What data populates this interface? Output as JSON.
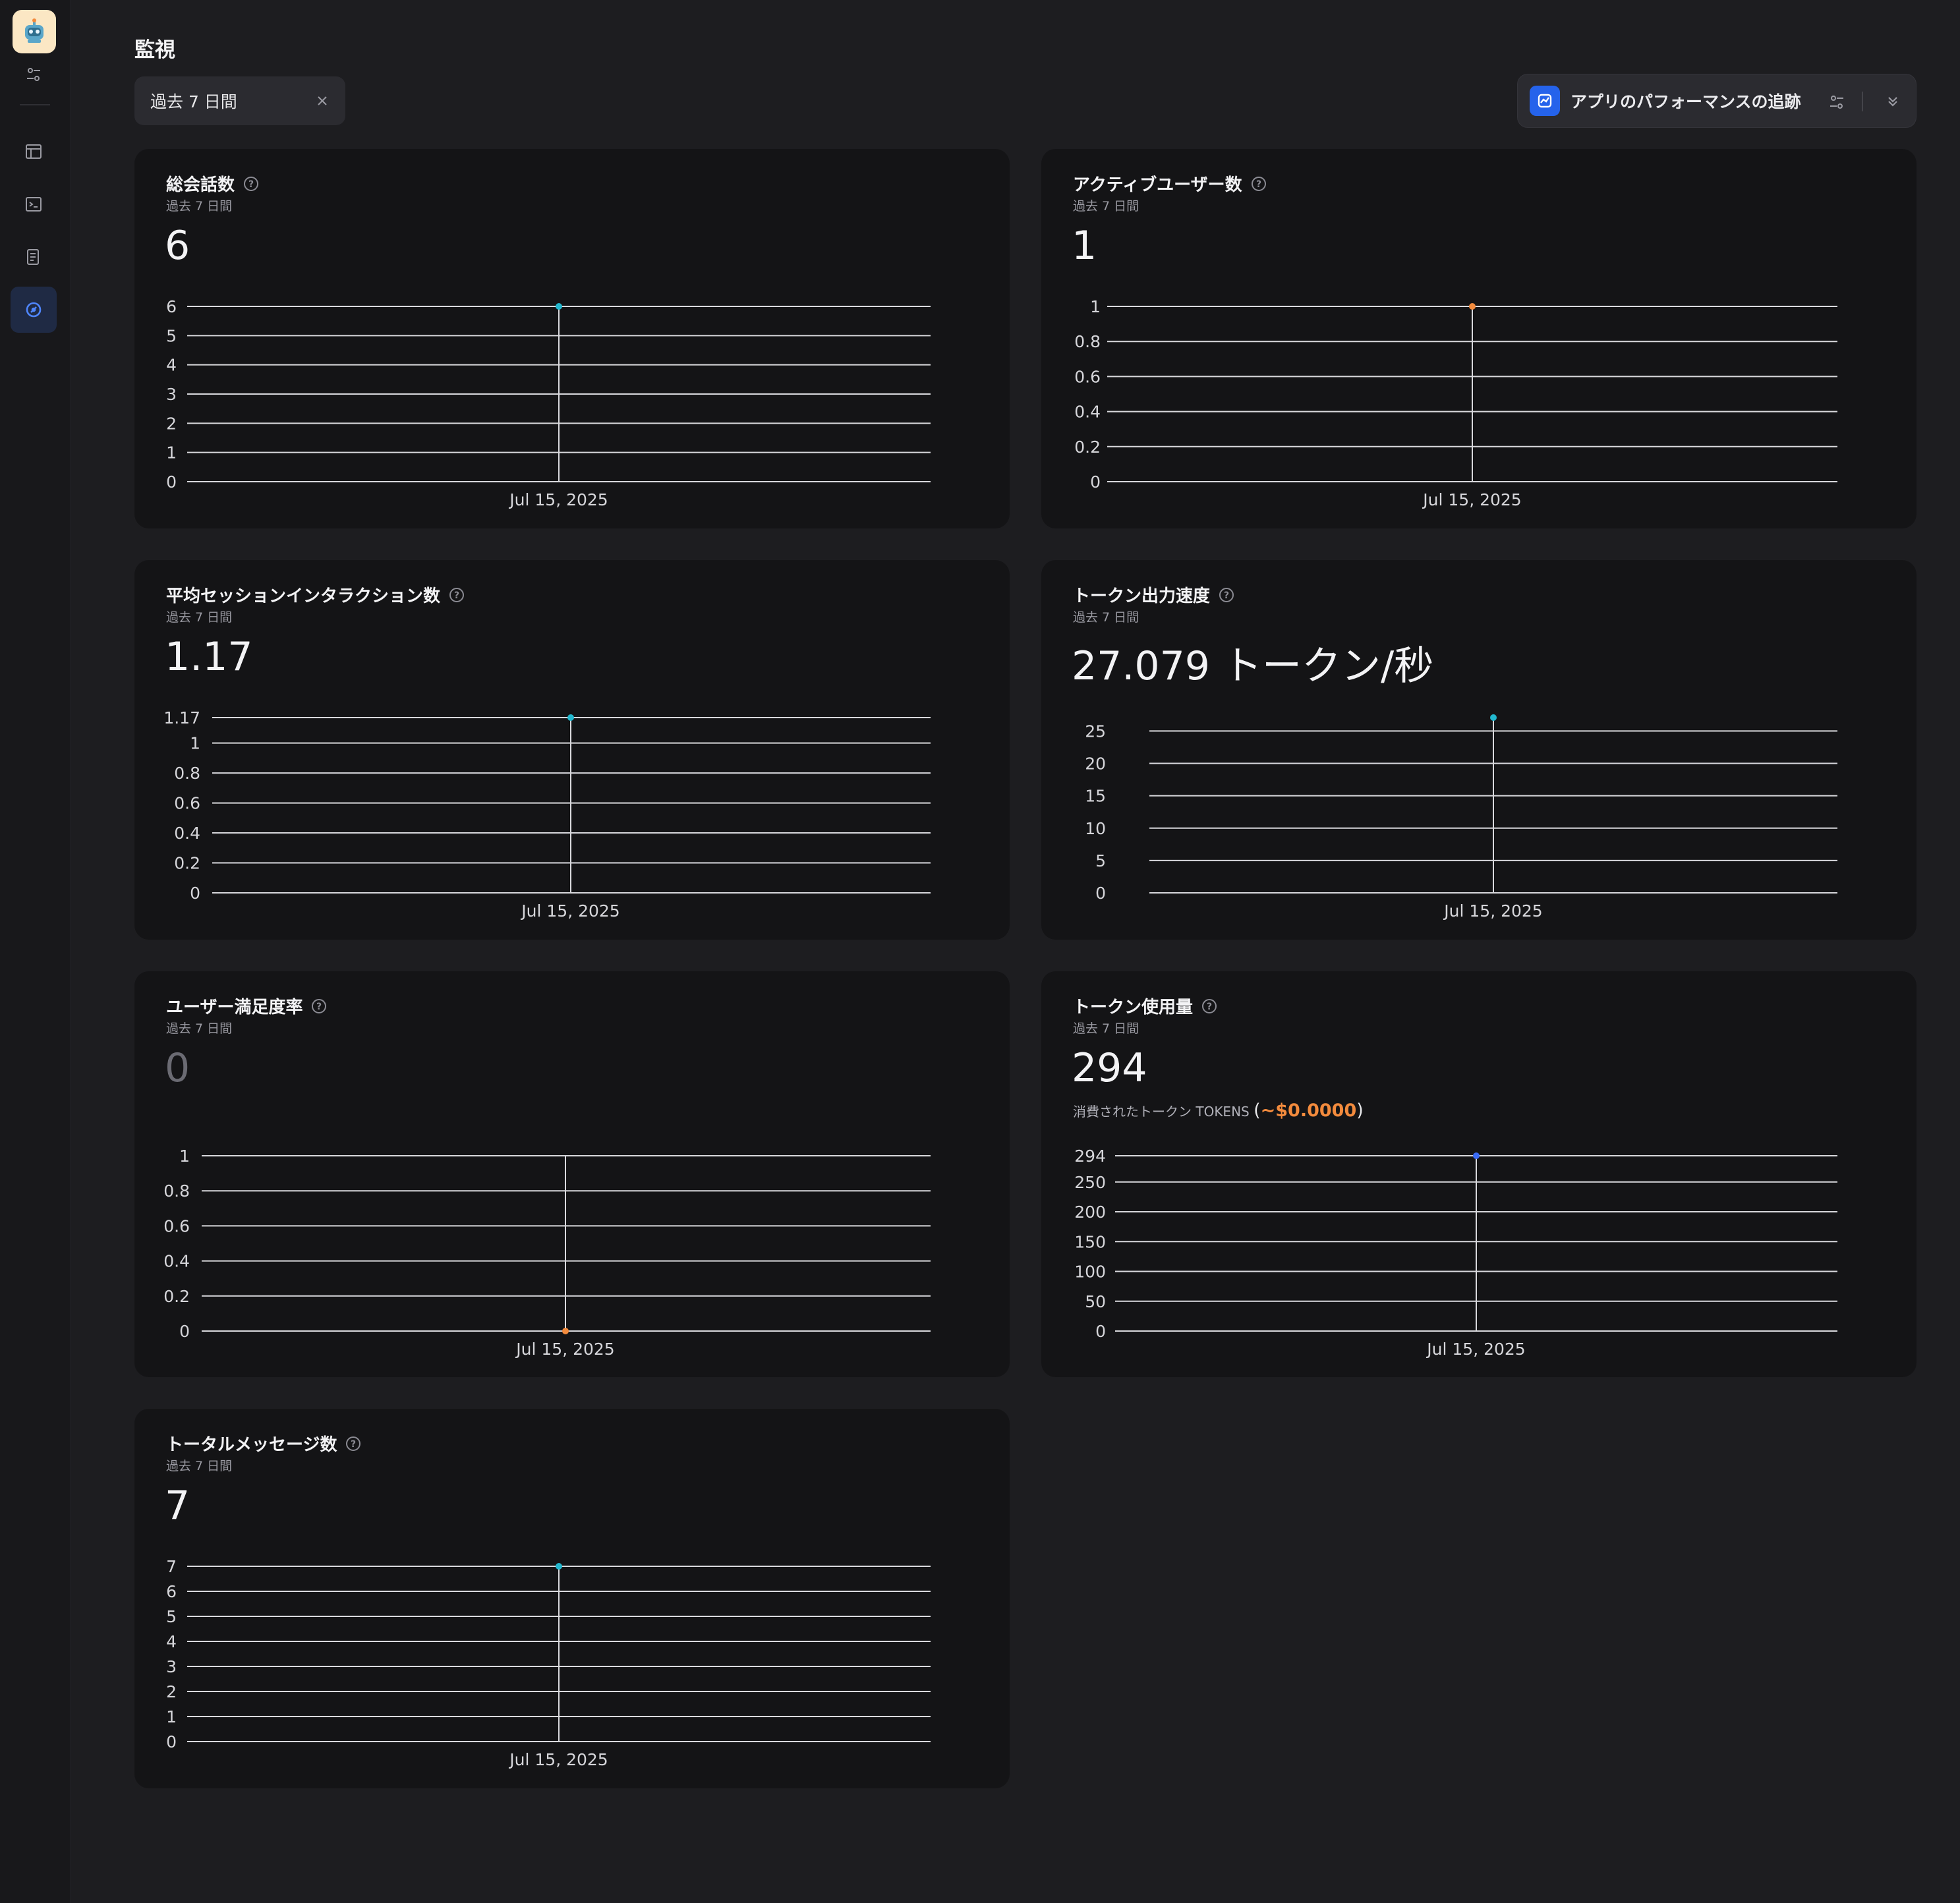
{
  "sidebar": {
    "active_index": 3
  },
  "header": {
    "title": "監視"
  },
  "filter": {
    "label": "過去 7 日間"
  },
  "tracing": {
    "label": "アプリのパフォーマンスの追跡"
  },
  "colors": {
    "accent_teal": "#22b8cf",
    "accent_orange": "#f38b3d",
    "accent_blue": "#3b6cf6",
    "brand_blue": "#2563eb"
  },
  "cards": [
    {
      "title": "総会話数",
      "subtitle": "過去 7 日間",
      "value": "6"
    },
    {
      "title": "アクティブユーザー数",
      "subtitle": "過去 7 日間",
      "value": "1"
    },
    {
      "title": "平均セッションインタラクション数",
      "subtitle": "過去 7 日間",
      "value": "1.17"
    },
    {
      "title": "トークン出力速度",
      "subtitle": "過去 7 日間",
      "value": "27.079 トークン/秒"
    },
    {
      "title": "ユーザー満足度率",
      "subtitle": "過去 7 日間",
      "value": "0"
    },
    {
      "title": "トークン使用量",
      "subtitle": "過去 7 日間",
      "value": "294",
      "tokens_label": "消費されたトークン TOKENS",
      "cost_open": "(",
      "cost": "~$0.0000",
      "cost_close": ")"
    },
    {
      "title": "トータルメッセージ数",
      "subtitle": "過去 7 日間",
      "value": "7"
    }
  ],
  "chart_data": [
    {
      "type": "line",
      "x": [
        "Jul 15, 2025"
      ],
      "series": [
        {
          "values": [
            6
          ]
        }
      ],
      "yticks": [
        "0",
        "1",
        "2",
        "3",
        "4",
        "5",
        "6"
      ],
      "ylim": [
        0,
        6
      ],
      "point_color": "#22b8cf"
    },
    {
      "type": "line",
      "x": [
        "Jul 15, 2025"
      ],
      "series": [
        {
          "values": [
            1
          ]
        }
      ],
      "yticks": [
        "0",
        "0.2",
        "0.4",
        "0.6",
        "0.8",
        "1"
      ],
      "ylim": [
        0,
        1
      ],
      "point_color": "#f38b3d"
    },
    {
      "type": "line",
      "x": [
        "Jul 15, 2025"
      ],
      "series": [
        {
          "values": [
            1.17
          ]
        }
      ],
      "yticks": [
        "0",
        "0.2",
        "0.4",
        "0.6",
        "0.8",
        "1",
        "1.17"
      ],
      "ylim": [
        0,
        1.17
      ],
      "point_color": "#22b8cf"
    },
    {
      "type": "line",
      "x": [
        "Jul 15, 2025"
      ],
      "series": [
        {
          "values": [
            27.079
          ]
        }
      ],
      "yticks": [
        "0",
        "5",
        "10",
        "15",
        "20",
        "25"
      ],
      "ylim": [
        0,
        27.079
      ],
      "point_color": "#22b8cf"
    },
    {
      "type": "line",
      "x": [
        "Jul 15, 2025"
      ],
      "series": [
        {
          "values": [
            0
          ]
        }
      ],
      "yticks": [
        "0",
        "0.2",
        "0.4",
        "0.6",
        "0.8",
        "1"
      ],
      "ylim": [
        0,
        1
      ],
      "point_color": "#f38b3d"
    },
    {
      "type": "line",
      "x": [
        "Jul 15, 2025"
      ],
      "series": [
        {
          "values": [
            294
          ]
        }
      ],
      "yticks": [
        "0",
        "50",
        "100",
        "150",
        "200",
        "250",
        "294"
      ],
      "ylim": [
        0,
        294
      ],
      "point_color": "#3b6cf6"
    },
    {
      "type": "line",
      "x": [
        "Jul 15, 2025"
      ],
      "series": [
        {
          "values": [
            7
          ]
        }
      ],
      "yticks": [
        "0",
        "1",
        "2",
        "3",
        "4",
        "5",
        "6",
        "7"
      ],
      "ylim": [
        0,
        7
      ],
      "point_color": "#22b8cf"
    }
  ]
}
